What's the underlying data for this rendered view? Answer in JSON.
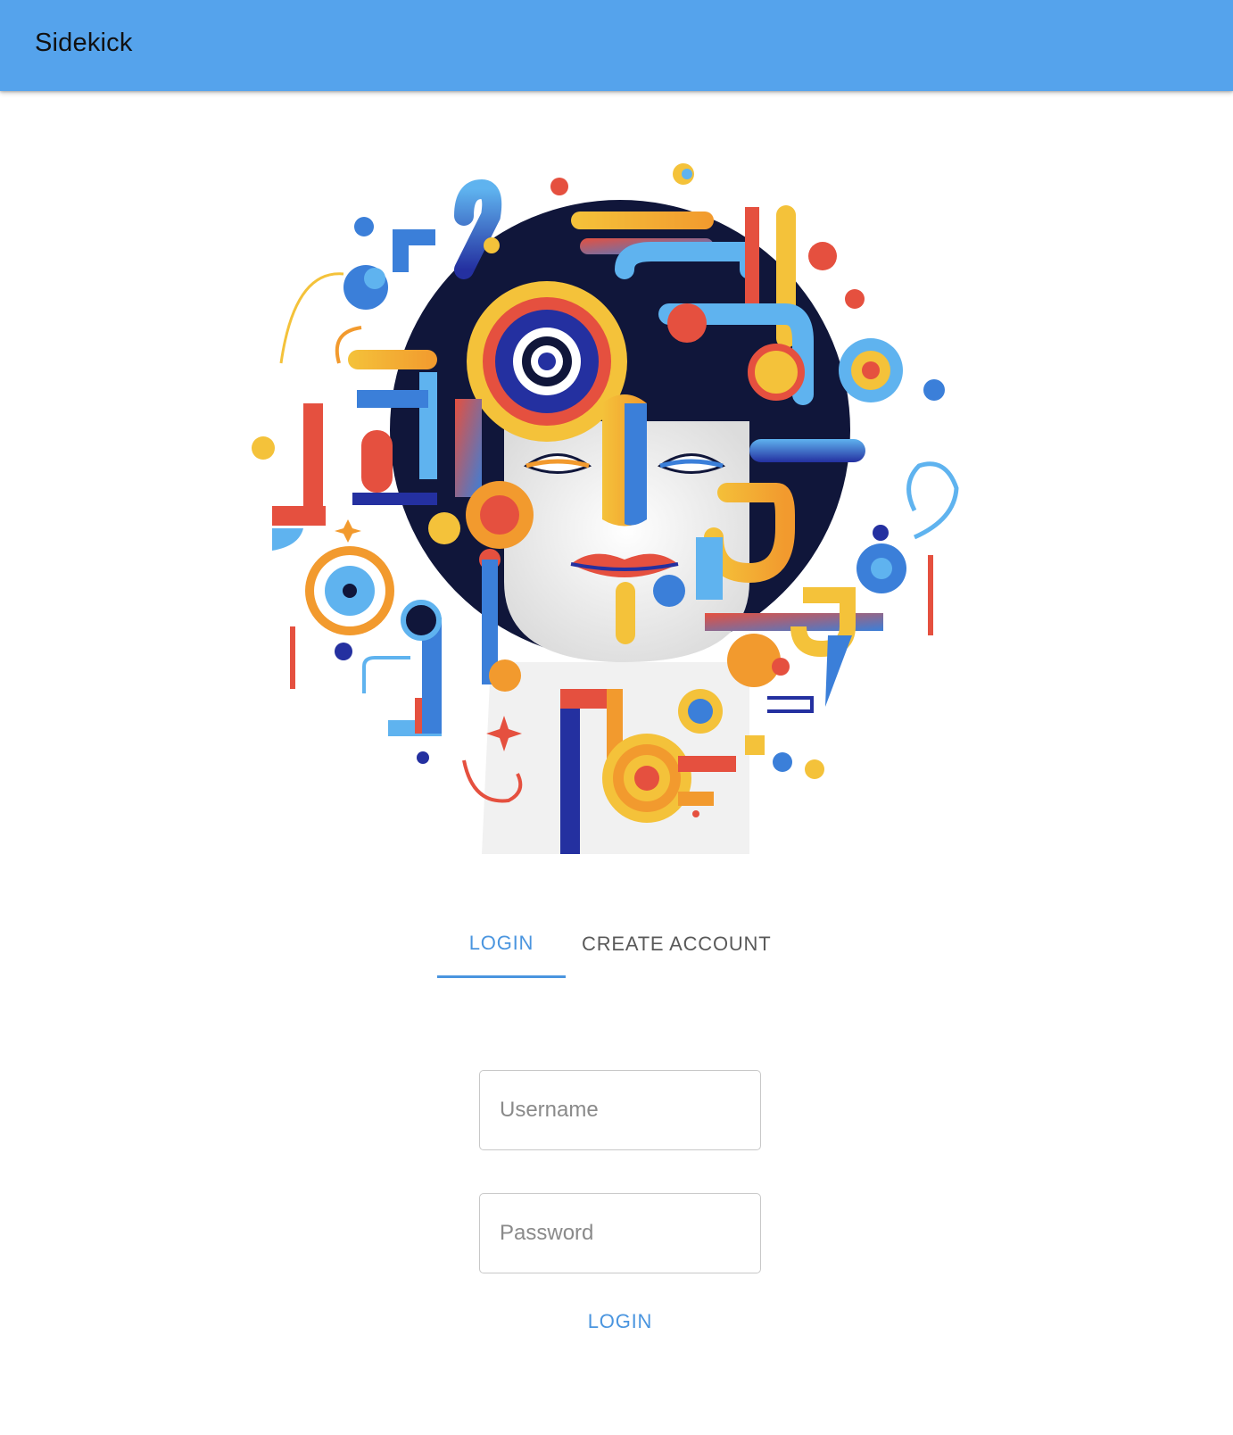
{
  "app": {
    "title": "Sidekick"
  },
  "tabs": [
    {
      "label": "LOGIN",
      "active": true
    },
    {
      "label": "CREATE ACCOUNT",
      "active": false
    }
  ],
  "form": {
    "username_placeholder": "Username",
    "password_placeholder": "Password",
    "submit_label": "LOGIN"
  },
  "colors": {
    "appbar": "#55a3ec",
    "accent": "#4a95df",
    "navy": "#10163a",
    "red": "#e5503f",
    "yellow": "#f4c23a",
    "orange": "#f29a2e",
    "blue": "#3b7fd9",
    "sky": "#5fb3ef",
    "indigo": "#2430a0"
  },
  "hero": {
    "icon": "abstract-face-illustration"
  }
}
